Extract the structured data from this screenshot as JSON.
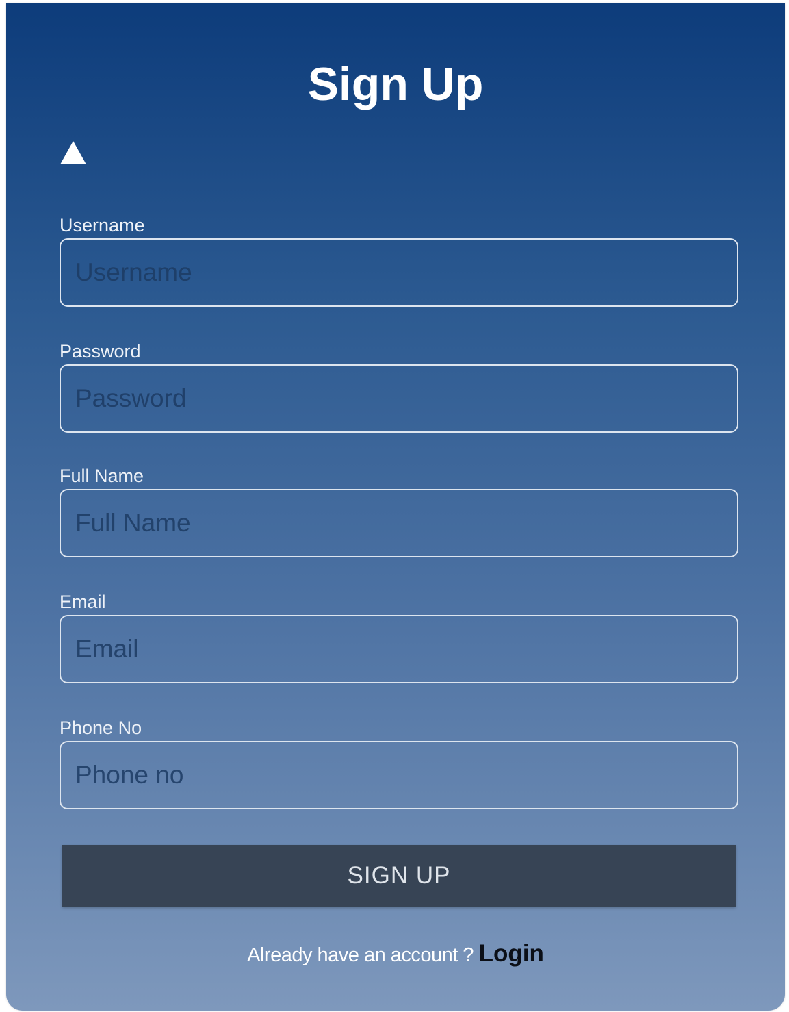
{
  "form": {
    "title": "Sign Up",
    "fields": [
      {
        "label": "Username",
        "placeholder": "Username"
      },
      {
        "label": "Password",
        "placeholder": "Password"
      },
      {
        "label": "Full Name",
        "placeholder": "Full Name"
      },
      {
        "label": "Email",
        "placeholder": "Email"
      },
      {
        "label": "Phone No",
        "placeholder": "Phone no"
      }
    ],
    "submit_label": "SIGN UP",
    "login_prompt": "Already have an account ? ",
    "login_link": "Login",
    "toggle_icon": "triangle-up-icon"
  },
  "colors": {
    "gradient_top": "#0d3c7b",
    "gradient_bottom": "#7e98bc",
    "button_bg": "#374455",
    "title_text": "#ffffff",
    "login_link": "#0b0f17"
  }
}
